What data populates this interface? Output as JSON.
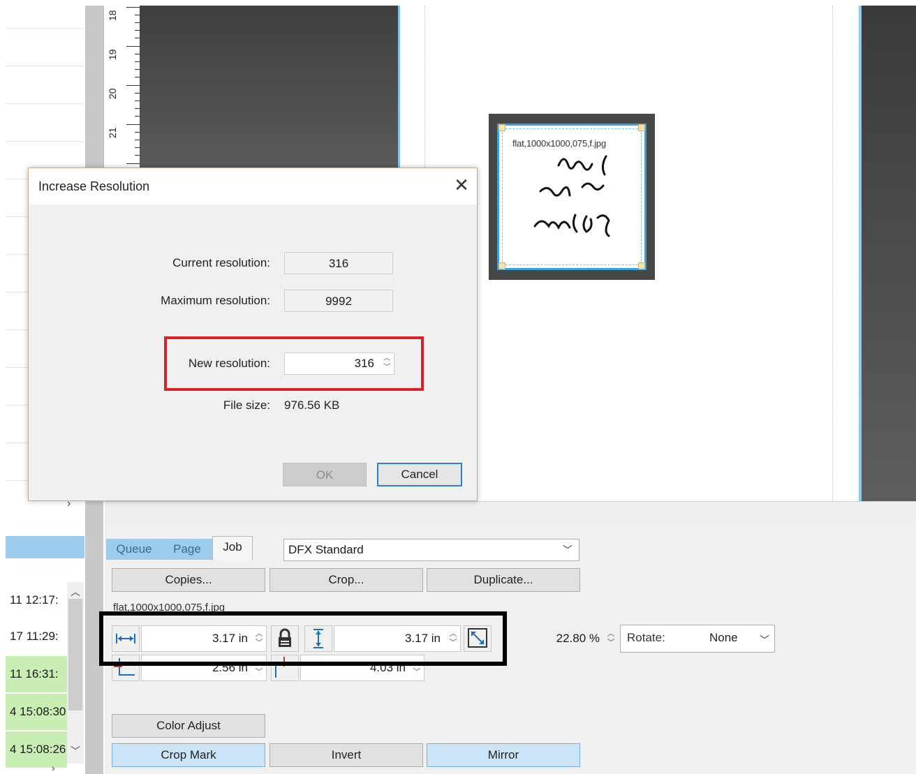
{
  "ruler": {
    "numbers": [
      "18",
      "19",
      "20",
      "21"
    ]
  },
  "thumbnail": {
    "filename": "flat,1000x1000,075,f.jpg"
  },
  "dialog": {
    "title": "Increase Resolution",
    "close_glyph": "✕",
    "current_label": "Current resolution:",
    "current_value": "316",
    "max_label": "Maximum resolution:",
    "max_value": "9992",
    "new_label": "New resolution:",
    "new_value": "316",
    "file_size_label": "File size:",
    "file_size_value": "976.56 KB",
    "ok_label": "OK",
    "cancel_label": "Cancel"
  },
  "queue": {
    "rows": [
      {
        "text": "11 12:17:"
      },
      {
        "text": "17 11:29:"
      },
      {
        "text": "11 16:31:"
      },
      {
        "text": "4 15:08:30"
      },
      {
        "text": "4 15:08:26"
      }
    ]
  },
  "tabs": {
    "queue": "Queue",
    "page": "Page",
    "job": "Job"
  },
  "profile": {
    "selected": "DFX Standard"
  },
  "buttons": {
    "copies": "Copies...",
    "crop": "Crop...",
    "duplicate": "Duplicate...",
    "color_adjust": "Color Adjust",
    "crop_mark": "Crop Mark",
    "invert": "Invert",
    "mirror": "Mirror"
  },
  "job": {
    "filename": "flat,1000x1000,075,f.jpg",
    "width": "3.17 in",
    "height": "3.17 in",
    "scale": "22.80 %",
    "x_offset": "2.56 in",
    "y_offset": "4.03 in",
    "rotate_label": "Rotate:",
    "rotate_value": "None"
  },
  "colors": {
    "accent_blue": "#36a3e0",
    "tab_blue": "#9ccbeb",
    "highlight_red": "#d8232a",
    "queue_green": "#c9eeb4"
  }
}
